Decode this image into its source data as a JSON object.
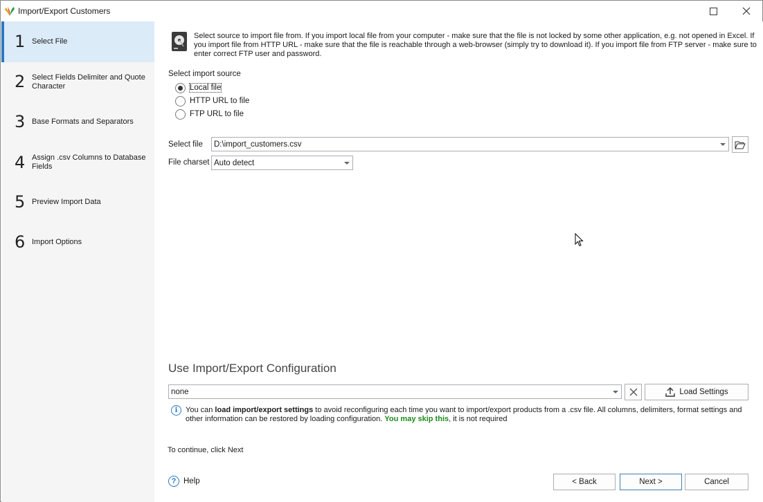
{
  "window": {
    "title": "Import/Export Customers"
  },
  "sidebar": {
    "steps": [
      {
        "number": "1",
        "label": "Select File",
        "active": true
      },
      {
        "number": "2",
        "label": "Select Fields Delimiter and Quote Character",
        "active": false
      },
      {
        "number": "3",
        "label": "Base Formats and Separators",
        "active": false
      },
      {
        "number": "4",
        "label": "Assign .csv Columns to Database Fields",
        "active": false
      },
      {
        "number": "5",
        "label": "Preview Import Data",
        "active": false
      },
      {
        "number": "6",
        "label": "Import Options",
        "active": false
      }
    ]
  },
  "main": {
    "info_text": "Select source to import file from. If you import local file from your computer - make sure that the file is not locked by some other application, e.g. not opened in Excel. If you import file from HTTP URL - make sure that the file is reachable through a web-browser (simply try to download it). If you import file from FTP server - make sure to enter correct FTP user and password.",
    "import_source_label": "Select import source",
    "import_sources": [
      {
        "label": "Local file",
        "checked": true
      },
      {
        "label": "HTTP URL to file",
        "checked": false
      },
      {
        "label": "FTP URL to file",
        "checked": false
      }
    ],
    "select_file_label": "Select file",
    "select_file_value": "D:\\import_customers.csv",
    "file_charset_label": "File charset",
    "file_charset_value": "Auto detect",
    "config_section_title": "Use Import/Export Configuration",
    "config_value": "none",
    "load_settings_label": "Load Settings",
    "config_info": {
      "part1": "You can ",
      "bold": "load import/export settings",
      "part2": " to avoid reconfiguring each time you want to import/export products from a .csv file. All columns, delimiters, format settings and other information can be restored by loading configuration. ",
      "green": "You may skip this",
      "part3": ", it is not required"
    },
    "continue_text": "To continue, click Next"
  },
  "footer": {
    "help_label": "Help",
    "back_label": "< Back",
    "next_label": "Next >",
    "cancel_label": "Cancel"
  },
  "colors": {
    "accent": "#2b79c2",
    "active_step_bg": "#dcebf8",
    "sidebar_bg": "#f5f5f5",
    "skip_green": "#1e8a1e"
  }
}
